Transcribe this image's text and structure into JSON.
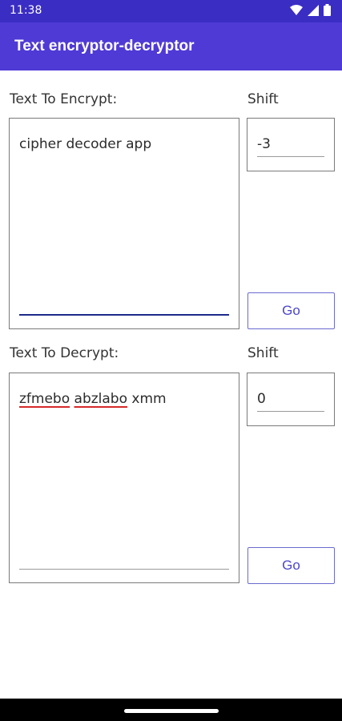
{
  "status_bar": {
    "time": "11:38"
  },
  "app_bar": {
    "title": "Text encryptor-decryptor"
  },
  "encrypt": {
    "label": "Text To Encrypt:",
    "text": "cipher decoder app",
    "shift_label": "Shift",
    "shift_value": "-3",
    "go_label": "Go"
  },
  "decrypt": {
    "label": "Text To Decrypt:",
    "words": [
      "zfmebo",
      "abzlabo",
      "xmm"
    ],
    "shift_label": "Shift",
    "shift_value": "0",
    "go_label": "Go"
  },
  "colors": {
    "accent": "#4f3ad6",
    "status_bar": "#3a2dc4",
    "spellcheck": "#d62a2a"
  }
}
